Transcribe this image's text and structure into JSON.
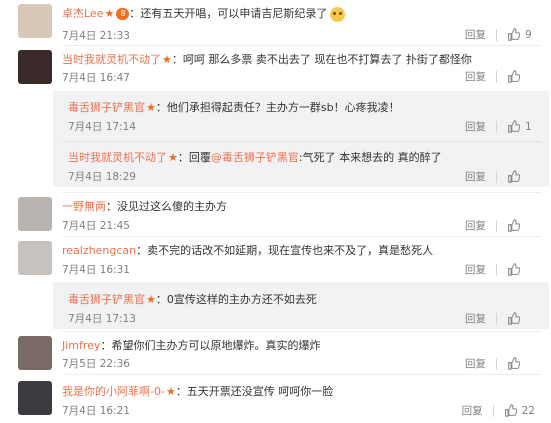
{
  "ui": {
    "reply_label": "回复",
    "star": "★",
    "emoji": "smile-emoji",
    "badge": "8"
  },
  "comments": [
    {
      "name": "卓杰Lee",
      "text": "：还有五天开唱，可以申请吉尼斯纪录了",
      "date": "7月4日 21:33",
      "likes": "9",
      "avatar_color": "#d7c8b8"
    },
    {
      "name": "当时我就灵机不动了",
      "text": "：呵呵 那么多票 卖不出去了 现在也不打算去了 扑街了都怪你",
      "date": "7月4日 16:47",
      "likes": "",
      "avatar_color": "#3a2a2a",
      "replies": [
        {
          "name": "毒舌狮子铲黑官",
          "text": "：他们承担得起责任？主办方一群sb！心疼我凌！",
          "date": "7月4日 17:14",
          "likes": "1"
        },
        {
          "name": "当时我就灵机不动了",
          "text": "：回覆@毒舌狮子铲黑官:气死了 本来想去的 真的醉了",
          "mention": "@毒舌狮子铲黑官",
          "date": "7月4日 18:29",
          "likes": ""
        }
      ]
    },
    {
      "name": "一野無两",
      "text": "：没见过这么傻的主办方",
      "date": "7月4日 21:45",
      "likes": "",
      "avatar_color": "#b9b4b0"
    },
    {
      "name": "realzhengcan",
      "text": "：卖不完的话改不如延期，现在宣传也来不及了，真是愁死人",
      "date": "7月4日 16:31",
      "likes": "",
      "avatar_color": "#c7c2bd",
      "replies": [
        {
          "name": "毒舌狮子铲黑官",
          "text": "：0宣传这样的主办方还不如去死",
          "date": "7月4日 17:13",
          "likes": ""
        }
      ]
    },
    {
      "name": "Jimfrey",
      "text": "：希望你们主办方可以原地爆炸。真实的爆炸",
      "date": "7月5日 22:36",
      "likes": "",
      "avatar_color": "#7a6a66"
    },
    {
      "name": "我是你的小阿菲啊-0-",
      "text": "：五天开票还没宣传 呵呵你一脸",
      "date": "7月4日 16:21",
      "likes": "22",
      "avatar_color": "#3b3b42"
    }
  ]
}
